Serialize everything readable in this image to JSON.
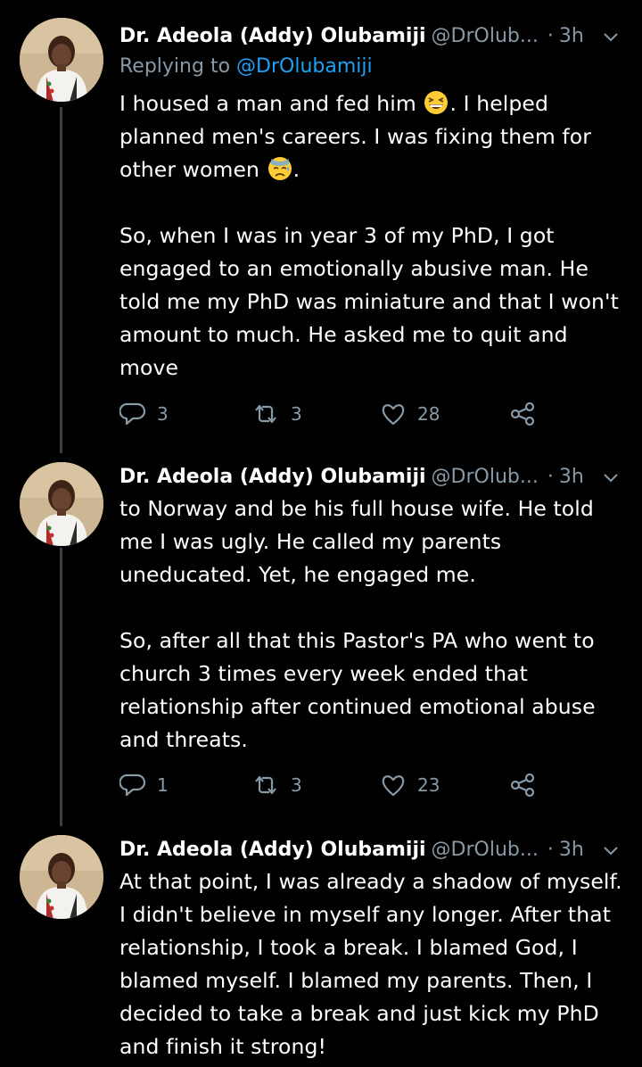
{
  "tweets": [
    {
      "author_name": "Dr. Adeola (Addy) Olubamiji",
      "author_handle": "@DrOlub...",
      "timestamp": "3h",
      "reply_prefix": "Replying to ",
      "reply_mention": "@DrOlubamiji",
      "text_parts": [
        "I housed a man and fed him ",
        ". I helped planned men's careers. I was fixing them for other women ",
        ".",
        "So, when I was in year 3 of my PhD, I got engaged to an emotionally abusive man. He told me my PhD was miniature and that I won't amount to much. He asked me to quit and move"
      ],
      "replies": "3",
      "retweets": "3",
      "likes": "28"
    },
    {
      "author_name": "Dr. Adeola (Addy) Olubamiji",
      "author_handle": "@DrOlub...",
      "timestamp": "3h",
      "text_parts": [
        "to Norway and be his full house wife. He told me I was ugly. He called my parents uneducated. Yet, he engaged me.",
        "So, after all that this Pastor's PA who went to church 3 times every week ended that relationship after continued emotional abuse and threats."
      ],
      "replies": "1",
      "retweets": "3",
      "likes": "23"
    },
    {
      "author_name": "Dr. Adeola (Addy) Olubamiji",
      "author_handle": "@DrOlub...",
      "timestamp": "3h",
      "text_parts": [
        "At that point, I was already a shadow of myself. I didn't believe in myself any longer. After that relationship, I took a break. I blamed God, I blamed myself. I blamed my parents. Then, I decided to take a break and just kick my PhD and finish it strong!"
      ]
    }
  ],
  "icons": {
    "reply": "reply-icon",
    "retweet": "retweet-icon",
    "like": "heart-icon",
    "share": "share-icon",
    "more": "chevron-down-icon"
  },
  "colors": {
    "background": "#000000",
    "text": "#ffffff",
    "muted": "#8899a6",
    "link": "#1da1f2",
    "thread_line": "#3a3f44"
  }
}
